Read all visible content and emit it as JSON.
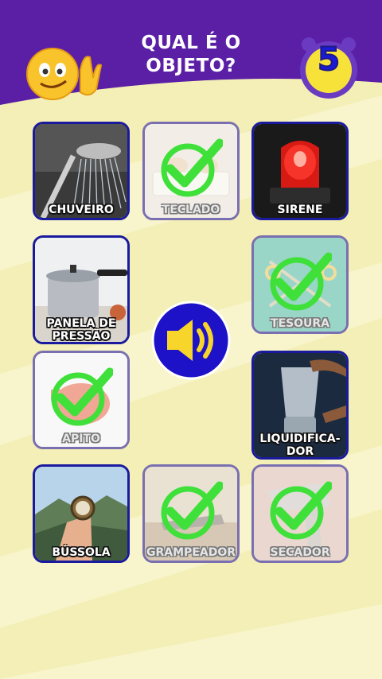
{
  "game": {
    "title_line1": "QUAL É O",
    "title_line2": "OBJETO?",
    "timer": "5"
  },
  "cards": [
    {
      "label": "CHUVEIRO",
      "found": false,
      "icon": "shower-icon"
    },
    {
      "label": "TECLADO",
      "found": true,
      "icon": "keyboard-icon"
    },
    {
      "label": "SIRENE",
      "found": false,
      "icon": "siren-icon"
    },
    {
      "label": "PANELA DE",
      "label2": "PRESSÃO",
      "found": false,
      "icon": "pressure-cooker-icon"
    },
    {
      "label": "TESOURA",
      "found": true,
      "icon": "scissors-icon"
    },
    {
      "label": "APITO",
      "found": true,
      "icon": "whistle-icon"
    },
    {
      "label": "LIQUIDIFICA-",
      "label2": "DOR",
      "found": false,
      "icon": "blender-icon"
    },
    {
      "label": "BÚSSOLA",
      "found": false,
      "icon": "compass-icon"
    },
    {
      "label": "GRAMPEADOR",
      "found": true,
      "icon": "stapler-icon"
    },
    {
      "label": "SECADOR",
      "found": true,
      "icon": "hair-dryer-icon"
    }
  ],
  "colors": {
    "header": "#5b1fa6",
    "background": "#f3efb6",
    "card_border": "#1a1a9e",
    "check": "#3fe03a",
    "speaker": "#1e12c9"
  }
}
